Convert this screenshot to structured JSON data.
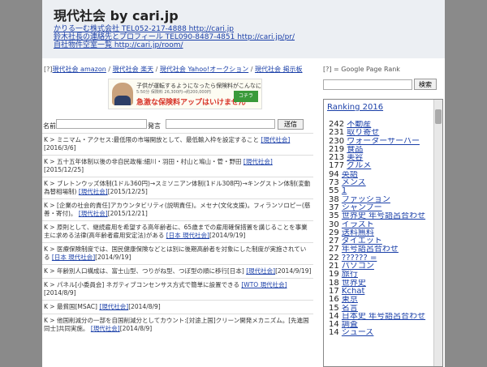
{
  "header": {
    "title": "現代社会 by cari.jp",
    "links": [
      "かりる一む株式会社 TEL052-217-4888 http://cari.jp",
      "鈴木社長の連絡先とプロフィール TEL090-8487-4851 http://cari.jp/pr/",
      "自社物件空室一覧 http://cari.jp/room/"
    ]
  },
  "nav": {
    "prefix": "[?]",
    "links": [
      "現代社会 amazon",
      "現代社会 楽天",
      "現代社会 Yahoo!オークション",
      "現代社会 掲示板"
    ]
  },
  "ad": {
    "line1": "子供が運転するようになったら保険料がこんなに上がった",
    "line2": "5:50分 保険料 26,300円→約200,000円",
    "line3": "急激な保険料アップはいけません",
    "badge": "コチラ"
  },
  "form": {
    "name_label": "名前",
    "message_label": "発言",
    "send_label": "送信"
  },
  "posts": [
    {
      "text": "K > ミニマム・アクセス:最低限の市場開放として、最低輸入枠を設定すること",
      "tag": "[現代社会]",
      "date": "[2016/3/6]"
    },
    {
      "text": "K > 五十五年体制以後の非自民政権:細川・羽田・村山と鳩山・菅・野田",
      "tag": "[現代社会]",
      "date": "[2015/12/25]"
    },
    {
      "text": "K > ブレトンウッズ体制(1ドル360円)→スミソニアン体制(1ドル308円)→キングストン体制(変動為替相場制)",
      "tag": "[現代社会]",
      "date": "[2015/12/25]"
    },
    {
      "text": "K > [企業の社会的責任]アカウンタビリティ(説明責任)。メセナ(文化支援)。フィランソロピー(慈善・寄付)。",
      "tag": "[現代社会]",
      "date": "[2015/12/21]"
    },
    {
      "text": "K > 原則として、継続雇用を希望する高年齢者に、65歳までの雇用確保措置を講じることを事業主に求める法律(高年齢者雇用安定法)がある",
      "tag": "[日本 現代社会]",
      "date": "[2014/9/19]"
    },
    {
      "text": "K > 医療保険制度では、国民健康保険などとは別に後期高齢者を対象にした制度が実施されている",
      "tag": "[日本 現代社会]",
      "date": "[2014/9/19]"
    },
    {
      "text": "K > 年齢別人口構成は、富士山型、つりがね型、つぼ型の順に移行[日本]",
      "tag": "[現代社会]",
      "date": "[2014/9/19]"
    },
    {
      "text": "K > パネル[小委員会] ネガティブコンセンサス方式で簡単に設置できる",
      "tag": "[WTO 現代社会]",
      "date": "[2014/8/9]"
    },
    {
      "text": "K > 最貧国[MSAC]",
      "tag": "[現代社会]",
      "date": "[2014/8/9]"
    },
    {
      "text": "K > 他国削減分の一部を自国削減分としてカウント:[対途上国]クリーン開発メカニズム。[先進国同士]共同実施。",
      "tag": "[現代社会]",
      "date": "[2014/8/9]"
    }
  ],
  "sidebar": {
    "gpr_label": "[?] = Google Page Rank",
    "search_button": "検索",
    "ranking_title": "Ranking 2016",
    "ranking": [
      {
        "count": "242",
        "label": "不動産"
      },
      {
        "count": "231",
        "label": "取り寄せ"
      },
      {
        "count": "230",
        "label": "ウォーターサーバー"
      },
      {
        "count": "219",
        "label": "食品"
      },
      {
        "count": "213",
        "label": "美容"
      },
      {
        "count": "177",
        "label": "グルメ"
      },
      {
        "count": "94",
        "label": "英語"
      },
      {
        "count": "73",
        "label": "メンズ"
      },
      {
        "count": "55",
        "label": "1"
      },
      {
        "count": "38",
        "label": "ファッション"
      },
      {
        "count": "37",
        "label": "シャンプー"
      },
      {
        "count": "35",
        "label": "世界史 年号語呂合わせ"
      },
      {
        "count": "30",
        "label": "イラスト"
      },
      {
        "count": "29",
        "label": "送料無料"
      },
      {
        "count": "27",
        "label": "ダイエット"
      },
      {
        "count": "27",
        "label": "年号語呂合わせ"
      },
      {
        "count": "22",
        "label": "?????? ="
      },
      {
        "count": "21",
        "label": "パソコン"
      },
      {
        "count": "19",
        "label": "旅行"
      },
      {
        "count": "18",
        "label": "世界史"
      },
      {
        "count": "17",
        "label": "Kchat"
      },
      {
        "count": "16",
        "label": "東京"
      },
      {
        "count": "15",
        "label": "名言"
      },
      {
        "count": "14",
        "label": "日本史 年号語呂合わせ"
      },
      {
        "count": "14",
        "label": "調査"
      },
      {
        "count": "14",
        "label": "シューズ"
      }
    ]
  }
}
